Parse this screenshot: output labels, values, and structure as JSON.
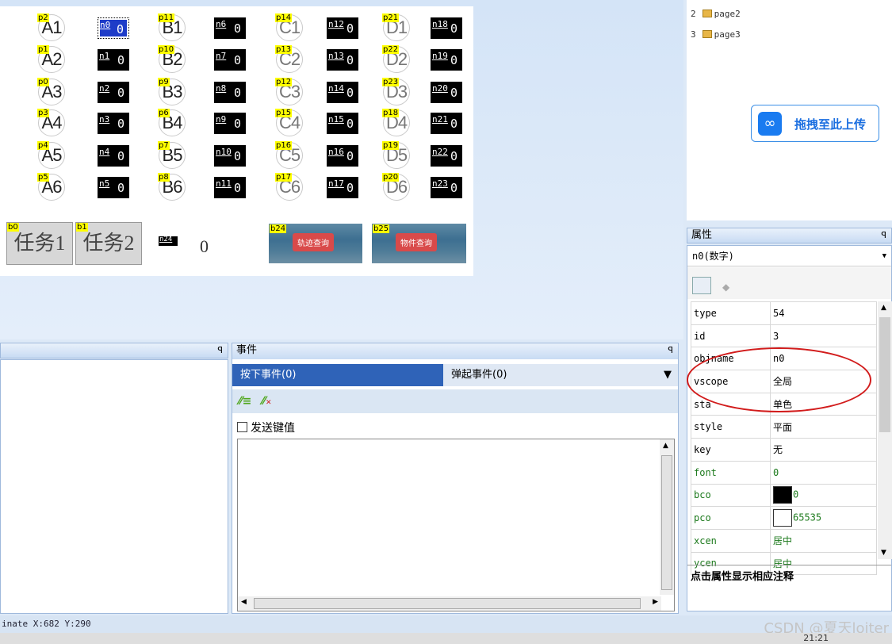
{
  "canvas": {
    "pictures": [
      {
        "tag": "p2",
        "text": "A1",
        "col": 0,
        "row": 0
      },
      {
        "tag": "p1",
        "text": "A2",
        "col": 0,
        "row": 1
      },
      {
        "tag": "p0",
        "text": "A3",
        "col": 0,
        "row": 2
      },
      {
        "tag": "p3",
        "text": "A4",
        "col": 0,
        "row": 3
      },
      {
        "tag": "p4",
        "text": "A5",
        "col": 0,
        "row": 4
      },
      {
        "tag": "p5",
        "text": "A6",
        "col": 0,
        "row": 5
      },
      {
        "tag": "p11",
        "text": "B1",
        "col": 1,
        "row": 0
      },
      {
        "tag": "p10",
        "text": "B2",
        "col": 1,
        "row": 1
      },
      {
        "tag": "p9",
        "text": "B3",
        "col": 1,
        "row": 2
      },
      {
        "tag": "p6",
        "text": "B4",
        "col": 1,
        "row": 3
      },
      {
        "tag": "p7",
        "text": "B5",
        "col": 1,
        "row": 4
      },
      {
        "tag": "p8",
        "text": "B6",
        "col": 1,
        "row": 5
      },
      {
        "tag": "p14",
        "text": "C1",
        "col": 2,
        "row": 0
      },
      {
        "tag": "p13",
        "text": "C2",
        "col": 2,
        "row": 1
      },
      {
        "tag": "p12",
        "text": "C3",
        "col": 2,
        "row": 2
      },
      {
        "tag": "p15",
        "text": "C4",
        "col": 2,
        "row": 3
      },
      {
        "tag": "p16",
        "text": "C5",
        "col": 2,
        "row": 4
      },
      {
        "tag": "p17",
        "text": "C6",
        "col": 2,
        "row": 5
      },
      {
        "tag": "p21",
        "text": "D1",
        "col": 3,
        "row": 0
      },
      {
        "tag": "p22",
        "text": "D2",
        "col": 3,
        "row": 1
      },
      {
        "tag": "p23",
        "text": "D3",
        "col": 3,
        "row": 2
      },
      {
        "tag": "p18",
        "text": "D4",
        "col": 3,
        "row": 3
      },
      {
        "tag": "p19",
        "text": "D5",
        "col": 3,
        "row": 4
      },
      {
        "tag": "p20",
        "text": "D6",
        "col": 3,
        "row": 5
      }
    ],
    "numbers": [
      {
        "label": "n0",
        "value": "0",
        "col": 0,
        "row": 0,
        "selected": true
      },
      {
        "label": "n1",
        "value": "0",
        "col": 0,
        "row": 1
      },
      {
        "label": "n2",
        "value": "0",
        "col": 0,
        "row": 2
      },
      {
        "label": "n3",
        "value": "0",
        "col": 0,
        "row": 3
      },
      {
        "label": "n4",
        "value": "0",
        "col": 0,
        "row": 4
      },
      {
        "label": "n5",
        "value": "0",
        "col": 0,
        "row": 5
      },
      {
        "label": "n6",
        "value": "0",
        "col": 1,
        "row": 0
      },
      {
        "label": "n7",
        "value": "0",
        "col": 1,
        "row": 1
      },
      {
        "label": "n8",
        "value": "0",
        "col": 1,
        "row": 2
      },
      {
        "label": "n9",
        "value": "0",
        "col": 1,
        "row": 3
      },
      {
        "label": "n10",
        "value": "0",
        "col": 1,
        "row": 4
      },
      {
        "label": "n11",
        "value": "0",
        "col": 1,
        "row": 5
      },
      {
        "label": "n12",
        "value": "0",
        "col": 2,
        "row": 0
      },
      {
        "label": "n13",
        "value": "0",
        "col": 2,
        "row": 1
      },
      {
        "label": "n14",
        "value": "0",
        "col": 2,
        "row": 2
      },
      {
        "label": "n15",
        "value": "0",
        "col": 2,
        "row": 3
      },
      {
        "label": "n16",
        "value": "0",
        "col": 2,
        "row": 4
      },
      {
        "label": "n17",
        "value": "0",
        "col": 2,
        "row": 5
      },
      {
        "label": "n18",
        "value": "0",
        "col": 3,
        "row": 0
      },
      {
        "label": "n19",
        "value": "0",
        "col": 3,
        "row": 1
      },
      {
        "label": "n20",
        "value": "0",
        "col": 3,
        "row": 2
      },
      {
        "label": "n21",
        "value": "0",
        "col": 3,
        "row": 3
      },
      {
        "label": "n22",
        "value": "0",
        "col": 3,
        "row": 4
      },
      {
        "label": "n23",
        "value": "0",
        "col": 3,
        "row": 5
      }
    ],
    "b0": {
      "tag": "b0",
      "label": "任务1"
    },
    "b1": {
      "tag": "b1",
      "label": "任务2"
    },
    "n24": {
      "tag": "n24",
      "value": "0"
    },
    "b24": {
      "tag": "b24",
      "label": "轨迹查询"
    },
    "b25": {
      "tag": "b25",
      "label": "物件查询"
    }
  },
  "pages": [
    {
      "num": "2",
      "name": "page2"
    },
    {
      "num": "3",
      "name": "page3"
    }
  ],
  "upload": {
    "label": "拖拽至此上传",
    "icon": "cloud-link-icon"
  },
  "properties": {
    "header": "属性",
    "object": "n0(数字)",
    "rows": [
      {
        "key": "type",
        "value": "54"
      },
      {
        "key": "id",
        "value": "3"
      },
      {
        "key": "objname",
        "value": "n0"
      },
      {
        "key": "vscope",
        "value": "全局"
      },
      {
        "key": "sta",
        "value": "单色"
      },
      {
        "key": "style",
        "value": "平面"
      },
      {
        "key": "key",
        "value": "无"
      },
      {
        "key": "font",
        "value": "0",
        "green": true
      },
      {
        "key": "bco",
        "value": "0",
        "green": true,
        "swatch": "#000000"
      },
      {
        "key": "pco",
        "value": "65535",
        "green": true,
        "swatch": "#ffffff"
      },
      {
        "key": "xcen",
        "value": "居中",
        "green": true
      },
      {
        "key": "ycen",
        "value": "居中",
        "green": true
      }
    ],
    "note": "点击属性显示相应注释"
  },
  "events": {
    "header": "事件",
    "tab_press": "按下事件(0)",
    "tab_release": "弹起事件(0)",
    "send_key": "发送键值"
  },
  "status": {
    "text": "inate X:682  Y:290"
  },
  "watermark": "CSDN @夏天loiter",
  "clock": "21:21",
  "colors": {
    "highlight": "#ffff00",
    "selection": "#1e3cc8",
    "annotation": "#d21c1c",
    "tab_active": "#2f63b8"
  }
}
